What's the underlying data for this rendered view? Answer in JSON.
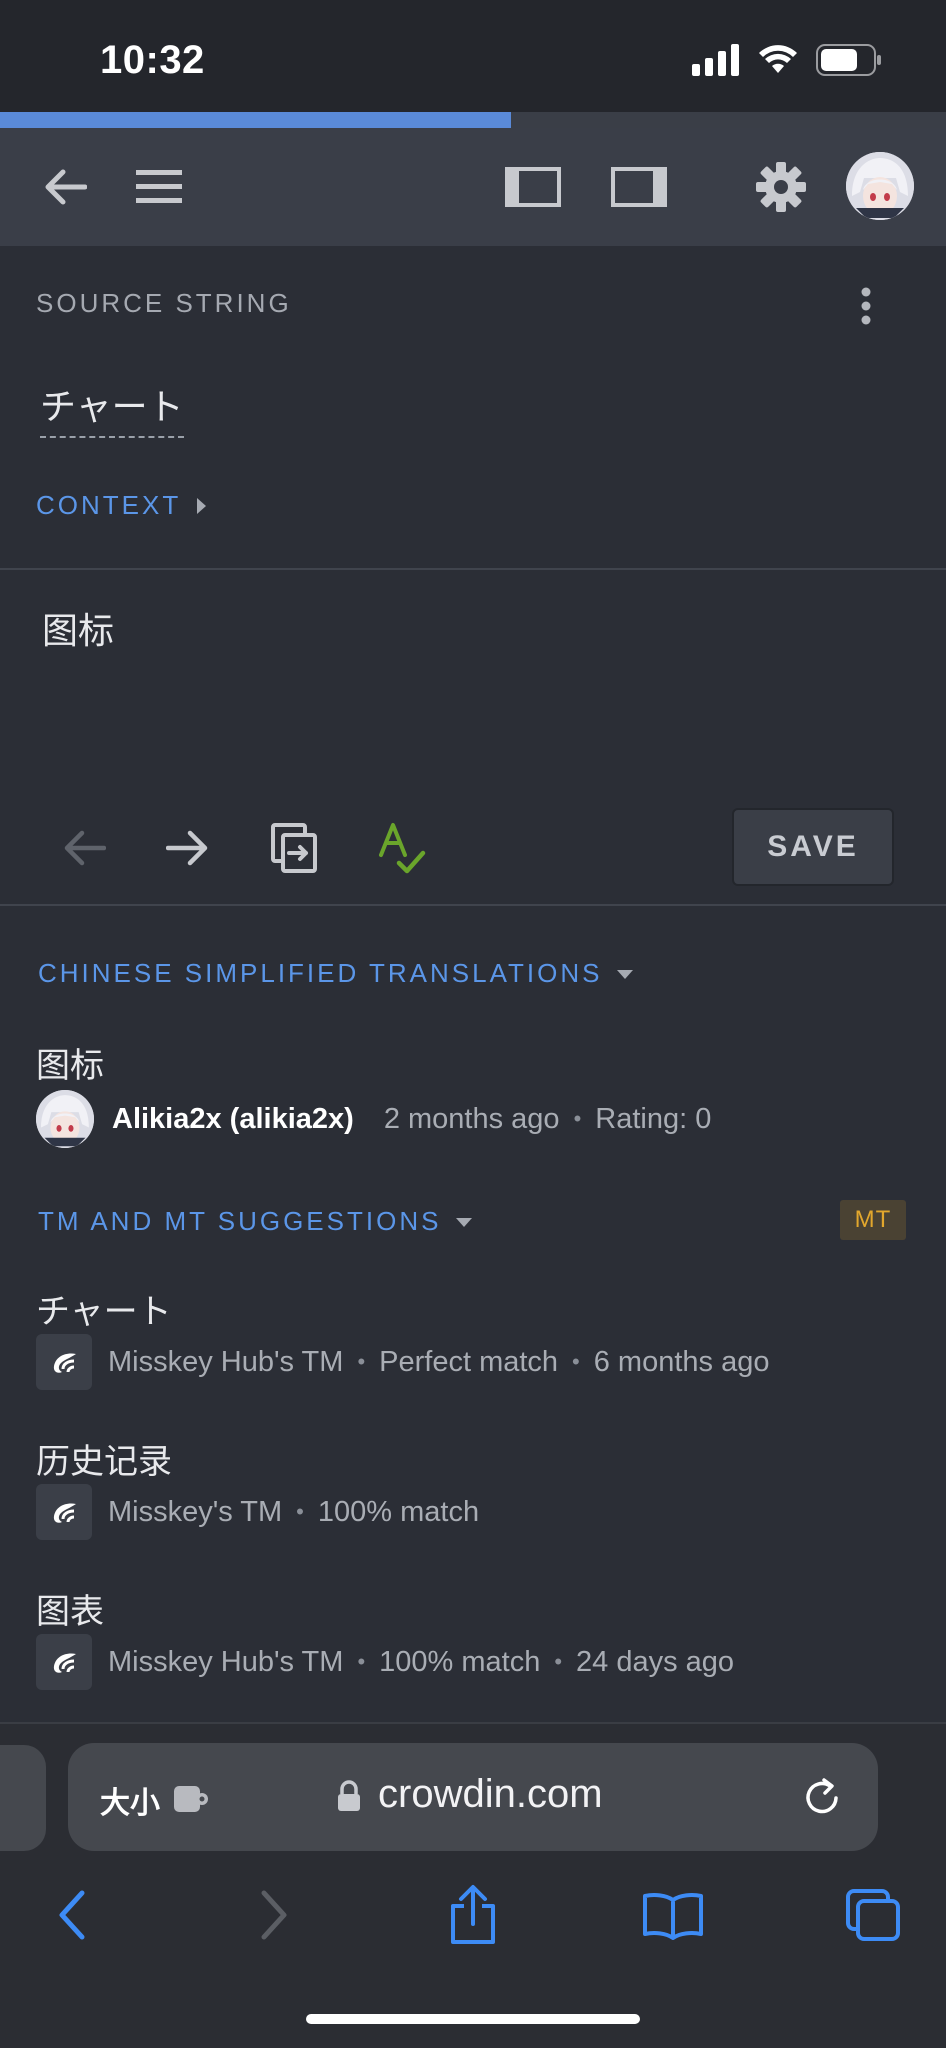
{
  "status": {
    "time": "10:32"
  },
  "page_progress": 0.54,
  "source": {
    "section_label": "SOURCE STRING",
    "text": "チャート",
    "context_label": "CONTEXT"
  },
  "editor": {
    "translation_text": "图标",
    "save_label": "SAVE"
  },
  "translations": {
    "header": "CHINESE SIMPLIFIED TRANSLATIONS",
    "items": [
      {
        "text": "图标",
        "author": "Alikia2x (alikia2x)",
        "time": "2 months ago",
        "rating": "Rating: 0"
      }
    ]
  },
  "suggestions": {
    "header": "TM AND MT SUGGESTIONS",
    "badge": "MT",
    "items": [
      {
        "text": "チャート",
        "source": "Misskey Hub's TM",
        "match": "Perfect match",
        "time": "6 months ago"
      },
      {
        "text": "历史记录",
        "source": "Misskey's TM",
        "match": "100% match",
        "time": ""
      },
      {
        "text": "图表",
        "source": "Misskey Hub's TM",
        "match": "100% match",
        "time": "24 days ago"
      }
    ]
  },
  "browser": {
    "text_size_label": "大小",
    "url": "crowdin.com"
  },
  "colors": {
    "accent": "#5b96e8",
    "background": "#2b2e36",
    "toolbar": "#3a3e48",
    "mt_badge_text": "#e2a72d",
    "spellcheck": "#6aa52b"
  },
  "icons": [
    "signal-icon",
    "wifi-icon",
    "battery-icon",
    "back-arrow-icon",
    "menu-icon",
    "left-panel-icon",
    "right-panel-icon",
    "gear-icon",
    "kebab-menu-icon",
    "caret-right-icon",
    "previous-arrow-icon",
    "next-arrow-icon",
    "copy-source-icon",
    "spellcheck-icon",
    "caret-down-icon",
    "tm-logo-icon",
    "extension-icon",
    "lock-icon",
    "reload-icon",
    "safari-back-icon",
    "safari-forward-icon",
    "share-icon",
    "bookmarks-icon",
    "tabs-icon"
  ]
}
